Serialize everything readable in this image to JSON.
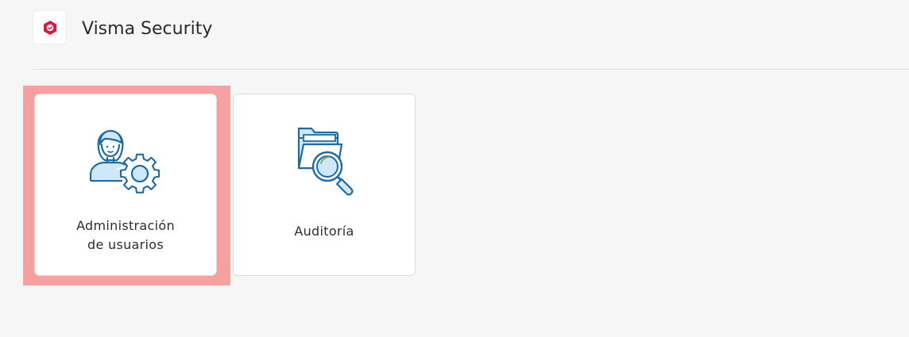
{
  "header": {
    "title": "Visma Security",
    "logo_icon": "shield-check-icon",
    "brand_color": "#e0183d"
  },
  "cards": [
    {
      "line1": "Administración",
      "line2": "de usuarios",
      "icon": "user-gear-icon",
      "highlighted": true
    },
    {
      "line1": "Auditoría",
      "line2": "",
      "icon": "folder-search-icon",
      "highlighted": false
    }
  ],
  "colors": {
    "icon_stroke": "#1c6aa6",
    "icon_fill_light": "#cfe7fb",
    "highlight": "#f6a0a0"
  }
}
